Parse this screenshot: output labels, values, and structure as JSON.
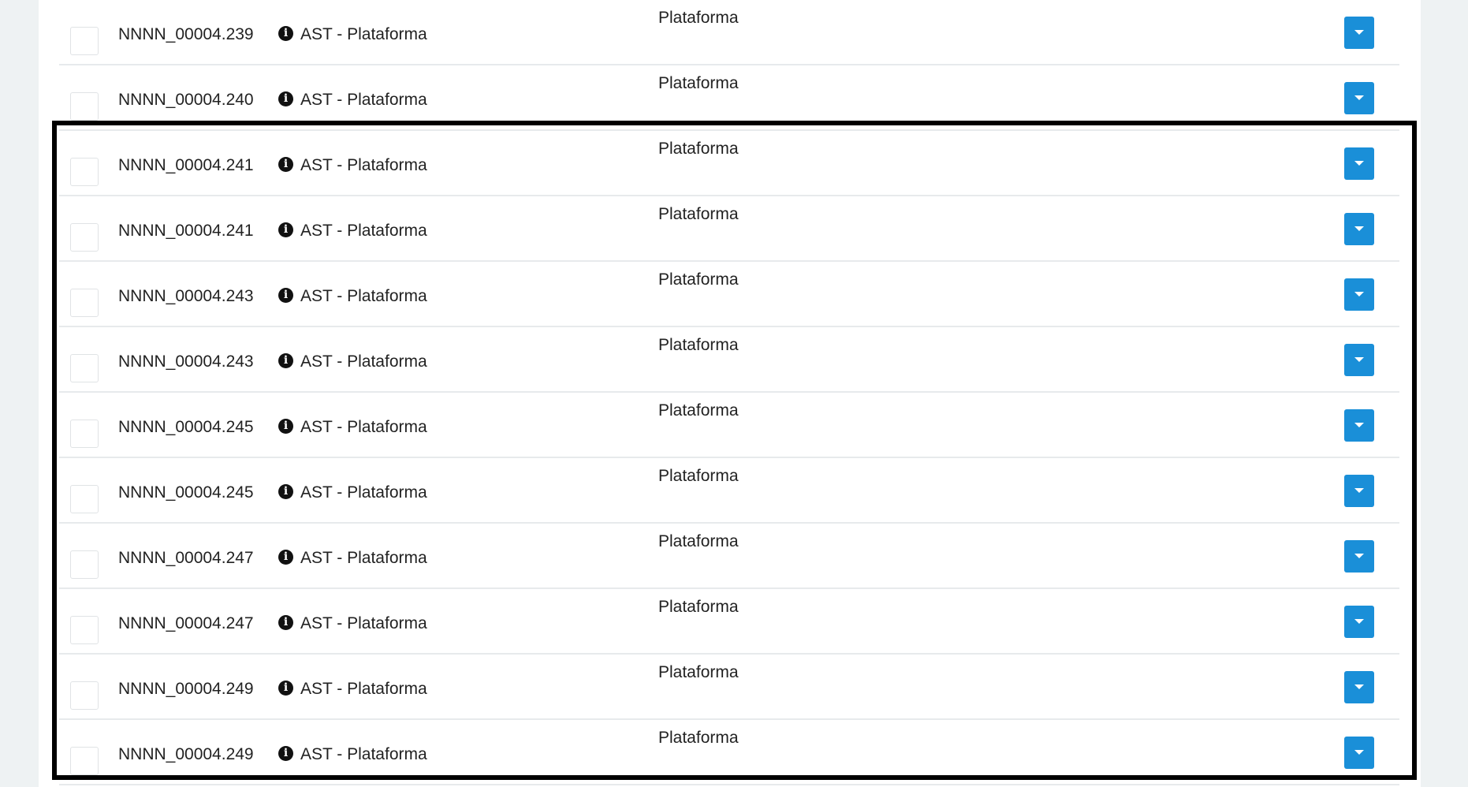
{
  "rows": [
    {
      "code": "NNNN_00004.239",
      "type": "AST - Plataforma",
      "desc": "Plataforma"
    },
    {
      "code": "NNNN_00004.240",
      "type": "AST - Plataforma",
      "desc": "Plataforma"
    },
    {
      "code": "NNNN_00004.241",
      "type": "AST - Plataforma",
      "desc": "Plataforma"
    },
    {
      "code": "NNNN_00004.241",
      "type": "AST - Plataforma",
      "desc": "Plataforma"
    },
    {
      "code": "NNNN_00004.243",
      "type": "AST - Plataforma",
      "desc": "Plataforma"
    },
    {
      "code": "NNNN_00004.243",
      "type": "AST - Plataforma",
      "desc": "Plataforma"
    },
    {
      "code": "NNNN_00004.245",
      "type": "AST - Plataforma",
      "desc": "Plataforma"
    },
    {
      "code": "NNNN_00004.245",
      "type": "AST - Plataforma",
      "desc": "Plataforma"
    },
    {
      "code": "NNNN_00004.247",
      "type": "AST - Plataforma",
      "desc": "Plataforma"
    },
    {
      "code": "NNNN_00004.247",
      "type": "AST - Plataforma",
      "desc": "Plataforma"
    },
    {
      "code": "NNNN_00004.249",
      "type": "AST - Plataforma",
      "desc": "Plataforma"
    },
    {
      "code": "NNNN_00004.249",
      "type": "AST - Plataforma",
      "desc": "Plataforma"
    }
  ],
  "colors": {
    "accent": "#1a8fd8",
    "background": "#eef2f3",
    "highlight_border": "#000000"
  },
  "icons": {
    "info": "info-icon",
    "dropdown": "caret-down-icon"
  }
}
